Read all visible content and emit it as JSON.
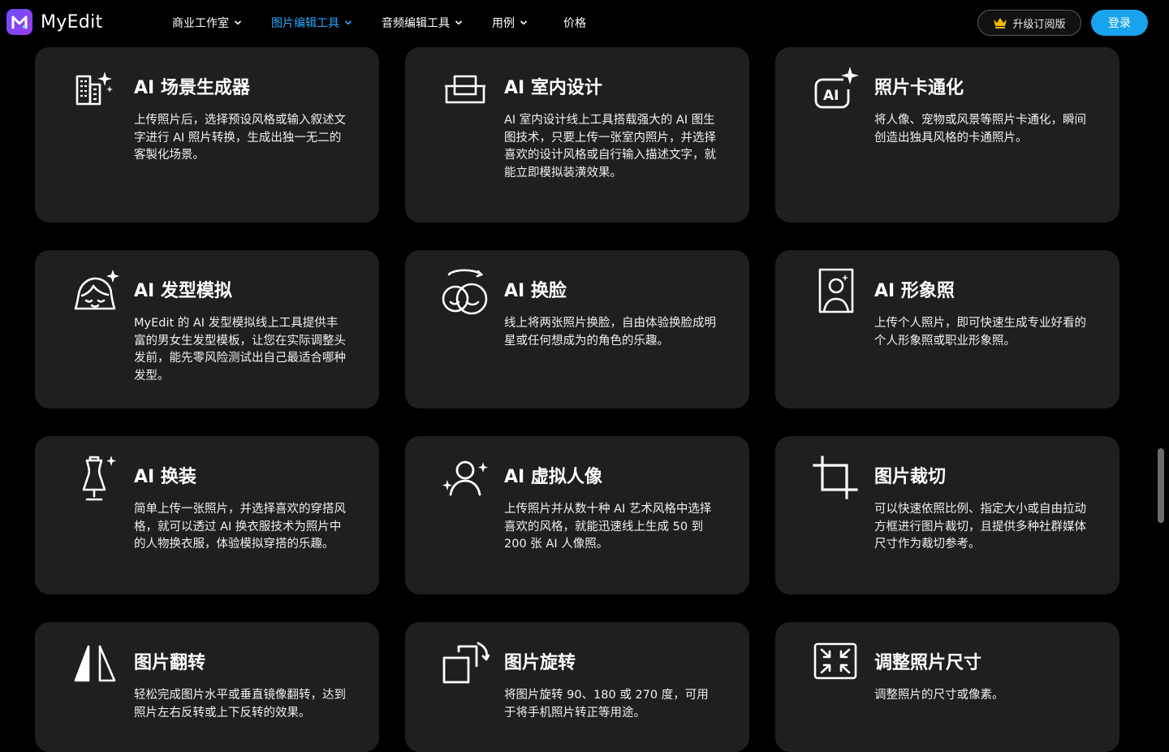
{
  "header": {
    "brand": "MyEdit",
    "nav": [
      {
        "label": "商业工作室",
        "has_chevron": true,
        "active": false
      },
      {
        "label": "图片编辑工具",
        "has_chevron": true,
        "active": true
      },
      {
        "label": "音频编辑工具",
        "has_chevron": true,
        "active": false
      },
      {
        "label": "用例",
        "has_chevron": true,
        "active": false
      },
      {
        "label": "价格",
        "has_chevron": false,
        "active": false
      }
    ],
    "upgrade_label": "升级订阅版",
    "login_label": "登录"
  },
  "cards": [
    {
      "icon": "city-sparkle-icon",
      "title": "AI 场景生成器",
      "desc": "上传照片后，选择预设风格或输入叙述文字进行 AI 照片转换，生成出独一无二的客製化场景。"
    },
    {
      "icon": "room-interior-icon",
      "title": "AI 室内设计",
      "desc": "AI 室内设计线上工具搭载强大的 AI 图生图技术，只要上传一张室内照片，并选择喜欢的设计风格或自行输入描述文字，就能立即模拟装潢效果。"
    },
    {
      "icon": "ai-cartoon-icon",
      "title": "照片卡通化",
      "desc": "将人像、宠物或风景等照片卡通化，瞬间创造出独具风格的卡通照片。"
    },
    {
      "icon": "hairstyle-face-icon",
      "title": "AI 发型模拟",
      "desc": "MyEdit 的 AI 发型模拟线上工具提供丰富的男女生发型模板，让您在实际调整头发前，能先零风险测试出自己最适合哪种发型。"
    },
    {
      "icon": "face-swap-icon",
      "title": "AI 换脸",
      "desc": "线上将两张照片换脸，自由体验换脸成明星或任何想成为的角色的乐趣。"
    },
    {
      "icon": "portrait-frame-icon",
      "title": "AI 形象照",
      "desc": "上传个人照片，即可快速生成专业好看的个人形象照或职业形象照。"
    },
    {
      "icon": "dress-form-icon",
      "title": "AI 换装",
      "desc": "简单上传一张照片，并选择喜欢的穿搭风格，就可以透过 AI 换衣服技术为照片中的人物换衣服，体验模拟穿搭的乐趣。"
    },
    {
      "icon": "avatar-sparkle-icon",
      "title": "AI 虚拟人像",
      "desc": "上传照片并从数十种 AI 艺术风格中选择喜欢的风格，就能迅速线上生成 50 到 200 张 AI 人像照。"
    },
    {
      "icon": "crop-icon",
      "title": "图片裁切",
      "desc": "可以快速依照比例、指定大小或自由拉动方框进行图片裁切，且提供多种社群媒体尺寸作为裁切参考。"
    },
    {
      "icon": "flip-icon",
      "title": "图片翻转",
      "desc": "轻松完成图片水平或垂直镜像翻转，达到照片左右反转或上下反转的效果。"
    },
    {
      "icon": "rotate-icon",
      "title": "图片旋转",
      "desc": "将图片旋转 90、180 或 270 度，可用于将手机照片转正等用途。"
    },
    {
      "icon": "resize-icon",
      "title": "调整照片尺寸",
      "desc": "调整照片的尺寸或像素。"
    }
  ],
  "colors": {
    "background": "#000000",
    "card": "#1f1f21",
    "active_nav": "#2ba7ff",
    "login_button": "#19a3ee"
  }
}
